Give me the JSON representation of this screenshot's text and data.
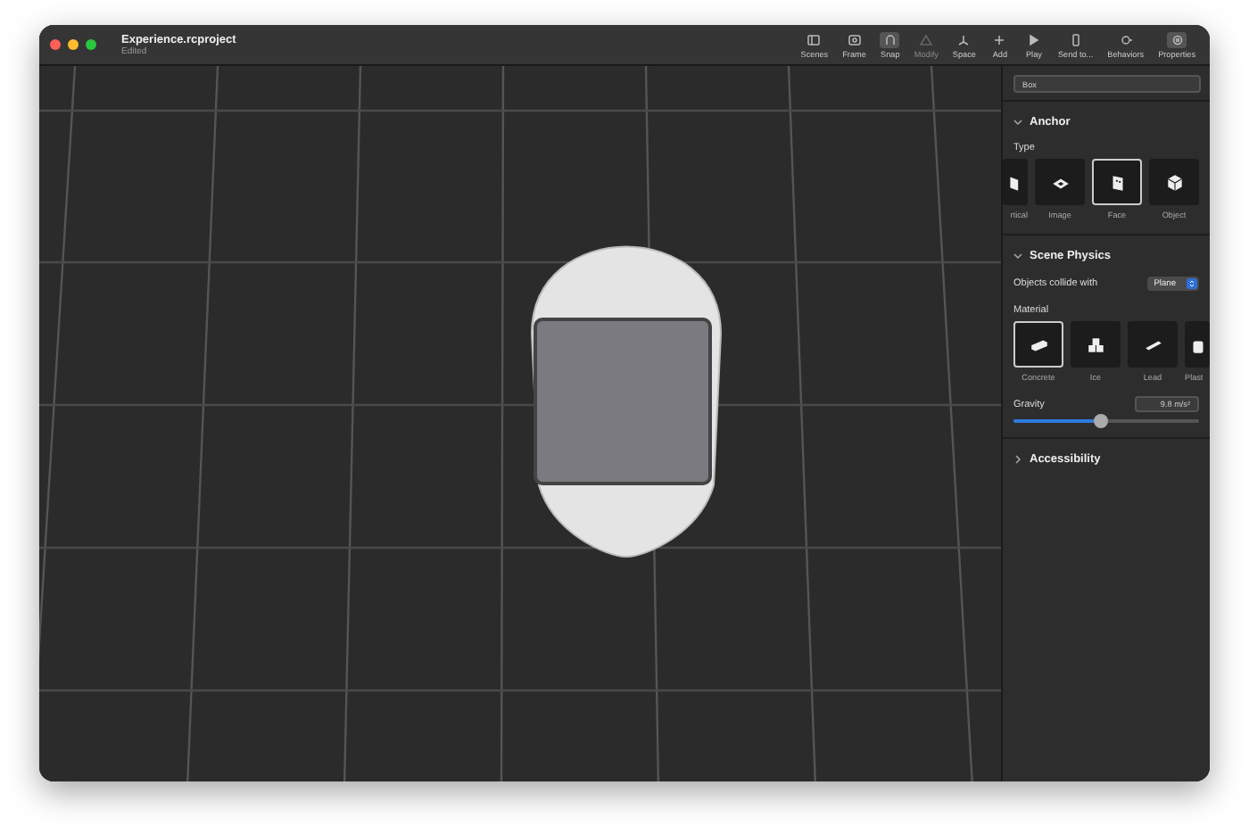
{
  "window": {
    "title": "Experience.rcproject",
    "subtitle": "Edited"
  },
  "toolbar": [
    {
      "label": "Scenes",
      "kind": "sidebar",
      "active": false,
      "disabled": false
    },
    {
      "label": "Frame",
      "kind": "frame",
      "active": false,
      "disabled": false
    },
    {
      "label": "Snap",
      "kind": "magnet",
      "active": true,
      "disabled": false
    },
    {
      "label": "Modify",
      "kind": "modify",
      "active": false,
      "disabled": true
    },
    {
      "label": "Space",
      "kind": "space",
      "active": false,
      "disabled": false
    },
    {
      "label": "Add",
      "kind": "plus",
      "active": false,
      "disabled": false
    },
    {
      "label": "Play",
      "kind": "play",
      "active": false,
      "disabled": false
    },
    {
      "label": "Send to...",
      "kind": "phone",
      "active": false,
      "disabled": false
    },
    {
      "label": "Behaviors",
      "kind": "behaviors",
      "active": false,
      "disabled": false
    },
    {
      "label": "Properties",
      "kind": "gear",
      "active": true,
      "disabled": false
    }
  ],
  "inspector": {
    "name_field": "Box",
    "anchor": {
      "title": "Anchor",
      "expanded": true,
      "type_label": "Type",
      "types": [
        {
          "label": "rtical",
          "kind": "vertical",
          "selected": false
        },
        {
          "label": "Image",
          "kind": "image",
          "selected": false
        },
        {
          "label": "Face",
          "kind": "face",
          "selected": true
        },
        {
          "label": "Object",
          "kind": "cube",
          "selected": false
        }
      ]
    },
    "physics": {
      "title": "Scene Physics",
      "expanded": true,
      "collide_label": "Objects collide with",
      "collide_value": "Plane",
      "material_label": "Material",
      "materials": [
        {
          "label": "Concrete",
          "kind": "concrete",
          "selected": true
        },
        {
          "label": "Ice",
          "kind": "ice",
          "selected": false
        },
        {
          "label": "Lead",
          "kind": "lead",
          "selected": false
        },
        {
          "label": "Plast",
          "kind": "plastic",
          "selected": false
        }
      ],
      "gravity_label": "Gravity",
      "gravity_value": "9.8 m/s²",
      "gravity": {
        "level": 0.47
      }
    },
    "accessibility": {
      "title": "Accessibility",
      "expanded": false
    }
  }
}
